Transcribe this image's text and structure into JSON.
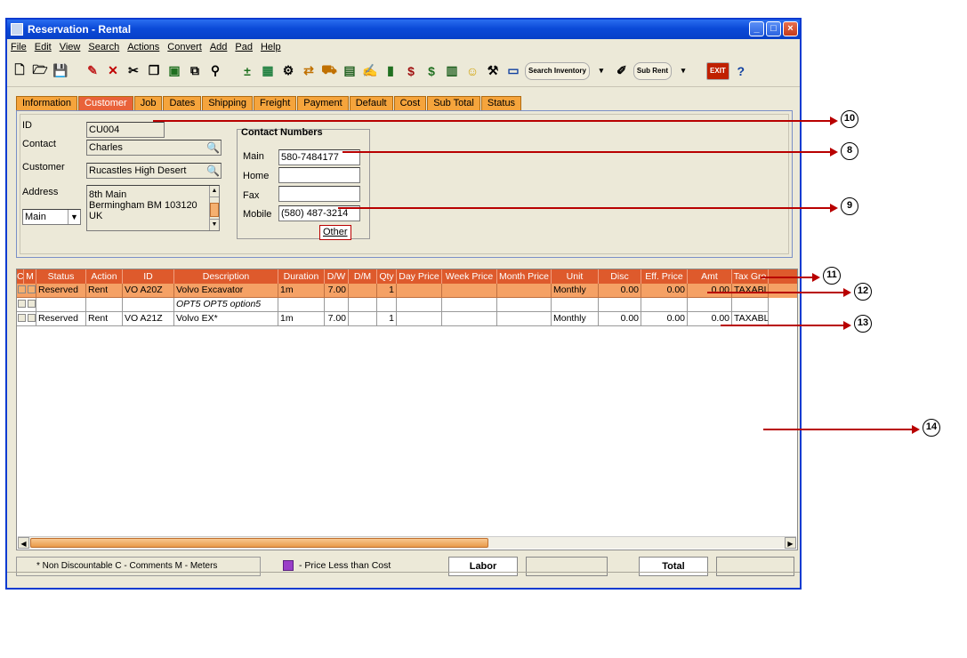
{
  "window": {
    "title": "Reservation - Rental",
    "min": "_",
    "max": "□",
    "close": "×"
  },
  "menu": [
    "File",
    "Edit",
    "View",
    "Search",
    "Actions",
    "Convert",
    "Add",
    "Pad",
    "Help"
  ],
  "toolbar": {
    "search_label": "Search Inventory",
    "subrent_label": "Sub Rent",
    "exit_label": "EXIT"
  },
  "tabs": [
    "Information",
    "Customer",
    "Job",
    "Dates",
    "Shipping",
    "Freight",
    "Payment",
    "Default",
    "Cost",
    "Sub Total",
    "Status"
  ],
  "customer": {
    "id_label": "ID",
    "id_value": "CU004",
    "contact_label": "Contact",
    "contact_value": "Charles",
    "customer_label": "Customer",
    "customer_value": "Rucastles High Desert",
    "address_label": "Address",
    "address_lines": [
      "8th Main",
      "Bermingham BM 103120",
      "UK"
    ],
    "address_type": "Main"
  },
  "contact_numbers": {
    "title": "Contact Numbers",
    "main_label": "Main",
    "main_value": "580-7484177",
    "home_label": "Home",
    "home_value": "",
    "fax_label": "Fax",
    "fax_value": "",
    "mobile_label": "Mobile",
    "mobile_value": "(580) 487-3214",
    "other_label": "Other"
  },
  "grid": {
    "columns": [
      "C",
      "M",
      "Status",
      "Action",
      "ID",
      "Description",
      "Duration",
      "D/W",
      "D/M",
      "Qty",
      "Day Price",
      "Week Price",
      "Month Price",
      "Unit",
      "Disc",
      "Eff. Price",
      "Amt",
      "Tax Gro"
    ],
    "rows": [
      {
        "status": "Reserved",
        "action": "Rent",
        "id": "VO A20Z",
        "desc": "Volvo Excavator",
        "duration": "1m",
        "dw": "7.00",
        "dm": "",
        "qty": "1",
        "day": "",
        "week": "",
        "month": "",
        "unit": "Monthly",
        "disc": "0.00",
        "eff": "0.00",
        "amt": "0.00",
        "tax": "TAXABLE"
      },
      {
        "status": "",
        "action": "",
        "id": "",
        "desc": "OPT5 OPT5 option5",
        "duration": "",
        "dw": "",
        "dm": "",
        "qty": "",
        "day": "",
        "week": "",
        "month": "",
        "unit": "",
        "disc": "",
        "eff": "",
        "amt": "",
        "tax": ""
      },
      {
        "status": "Reserved",
        "action": "Rent",
        "id": "VO A21Z",
        "desc": "Volvo EX*",
        "duration": "1m",
        "dw": "7.00",
        "dm": "",
        "qty": "1",
        "day": "",
        "week": "",
        "month": "",
        "unit": "Monthly",
        "disc": "0.00",
        "eff": "0.00",
        "amt": "0.00",
        "tax": "TAXABLE"
      }
    ]
  },
  "footer": {
    "legend": "* Non Discountable  C - Comments  M - Meters",
    "price_note": "- Price Less than Cost",
    "labor_label": "Labor",
    "total_label": "Total"
  },
  "callouts": [
    "10",
    "8",
    "9",
    "11",
    "12",
    "13",
    "14"
  ],
  "colors": {
    "tab_bg": "#f5a43c",
    "tab_active": "#e9623a",
    "grid_header": "#de5a2c",
    "selected_row": "#f5a165",
    "callout": "#b80000",
    "price_swatch": "#9a3ec8"
  }
}
